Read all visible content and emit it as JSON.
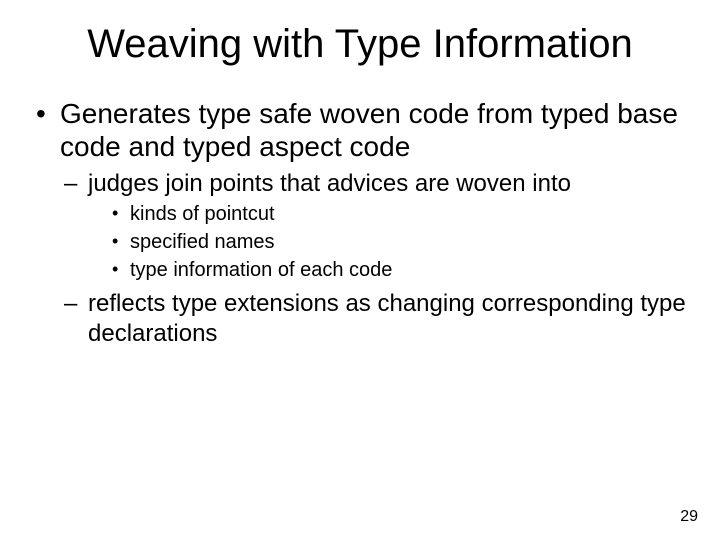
{
  "title": "Weaving with Type Information",
  "bullets": {
    "b1": "Generates type safe woven code from typed base code and typed aspect code",
    "b1_1": "judges join points that advices are woven into",
    "b1_1_1": "kinds of pointcut",
    "b1_1_2": "specified names",
    "b1_1_3": "type information of each code",
    "b1_2": "reflects type extensions as changing corresponding type declarations"
  },
  "page_number": "29"
}
